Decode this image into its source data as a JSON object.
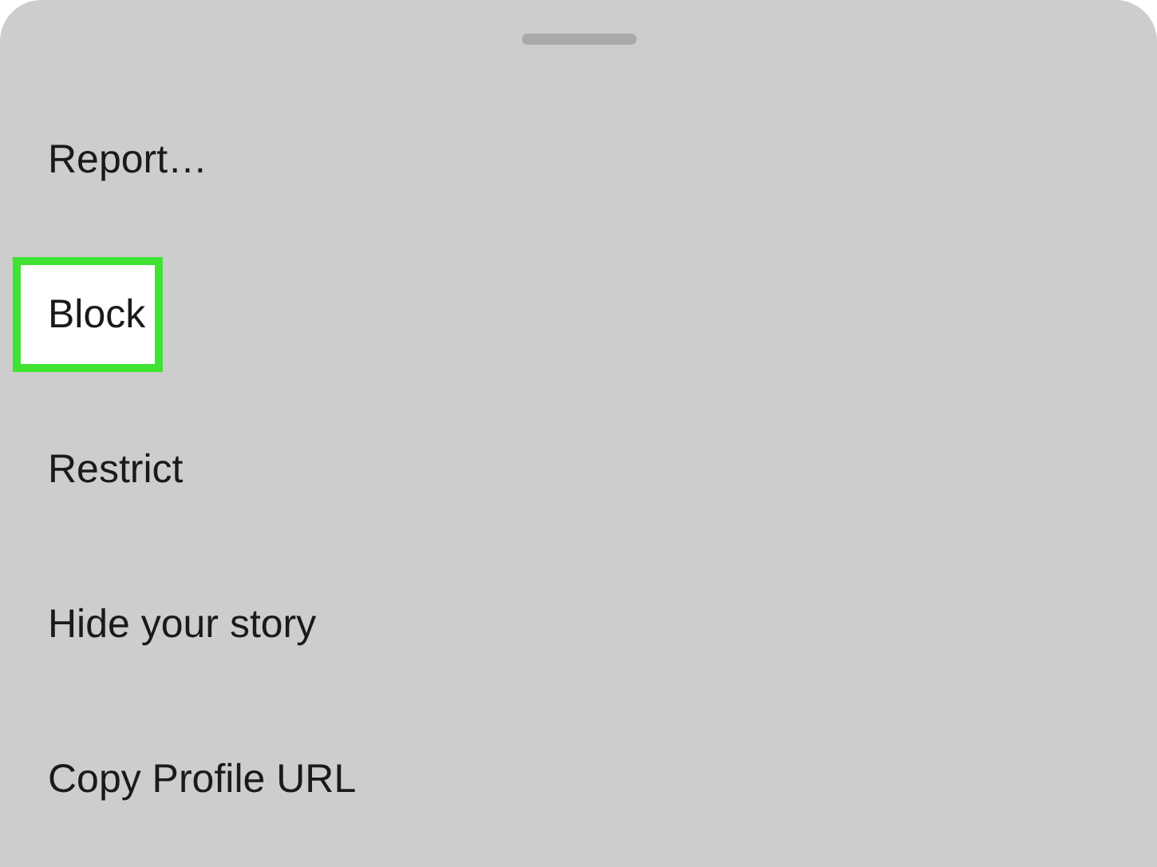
{
  "sheet": {
    "items": [
      {
        "label": "Report…",
        "highlighted": false
      },
      {
        "label": "Block",
        "highlighted": true
      },
      {
        "label": "Restrict",
        "highlighted": false
      },
      {
        "label": "Hide your story",
        "highlighted": false
      },
      {
        "label": "Copy Profile URL",
        "highlighted": false
      }
    ]
  }
}
